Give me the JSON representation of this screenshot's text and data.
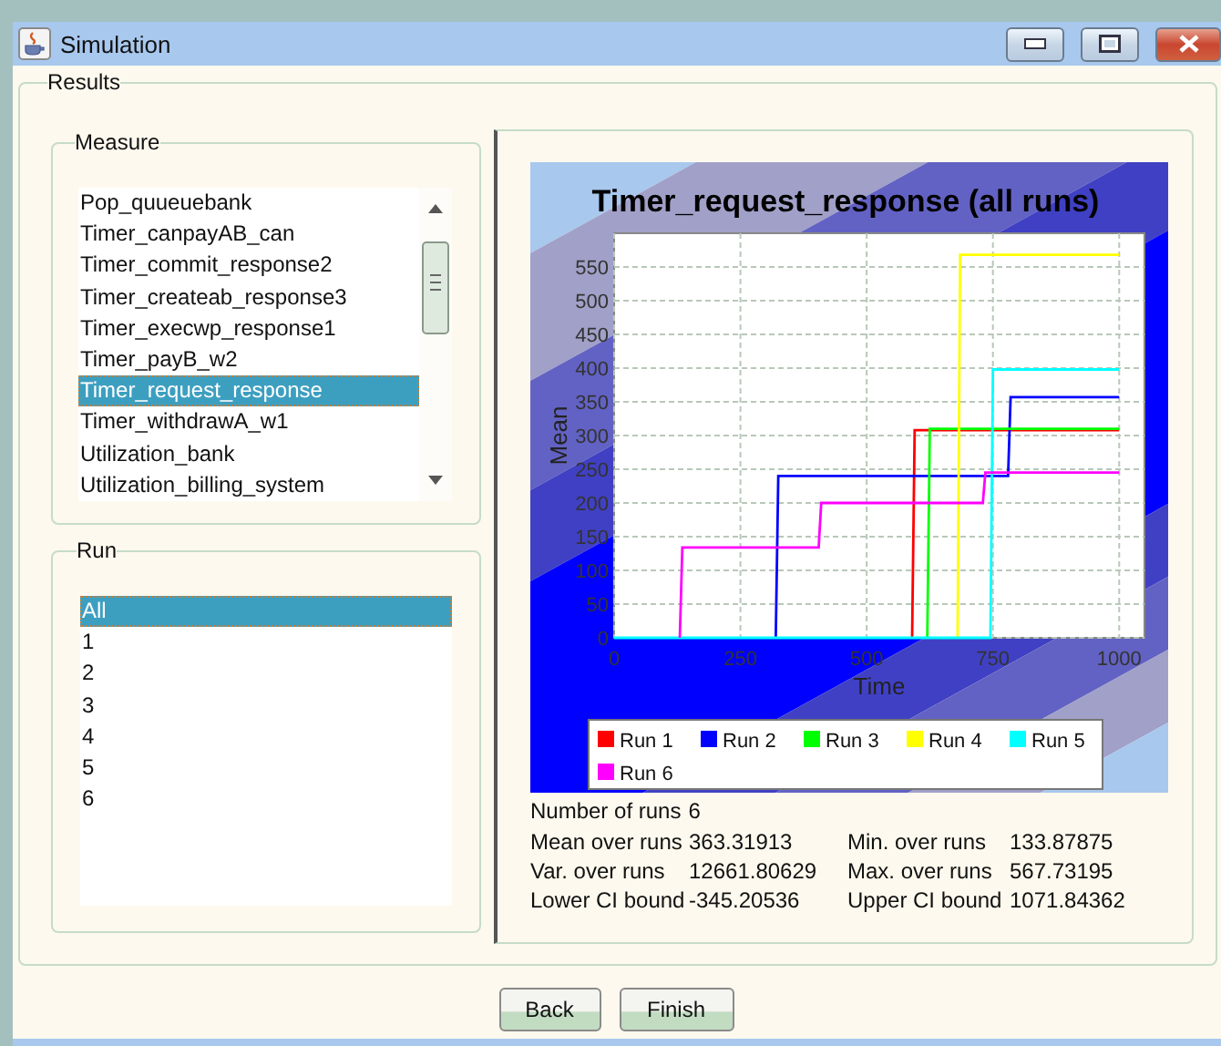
{
  "window": {
    "title": "Simulation"
  },
  "results": {
    "title": "Results"
  },
  "measure": {
    "title": "Measure",
    "items": [
      {
        "label": "Pop_quueuebank",
        "selected": false
      },
      {
        "label": "Timer_canpayAB_can",
        "selected": false
      },
      {
        "label": "Timer_commit_response2",
        "selected": false
      },
      {
        "label": "Timer_createab_response3",
        "selected": false
      },
      {
        "label": "Timer_execwp_response1",
        "selected": false
      },
      {
        "label": "Timer_payB_w2",
        "selected": false
      },
      {
        "label": "Timer_request_response",
        "selected": true
      },
      {
        "label": "Timer_withdrawA_w1",
        "selected": false
      },
      {
        "label": "Utilization_bank",
        "selected": false
      },
      {
        "label": "Utilization_billing_system",
        "selected": false
      }
    ]
  },
  "run": {
    "title": "Run",
    "items": [
      {
        "label": "All",
        "selected": true
      },
      {
        "label": "1",
        "selected": false
      },
      {
        "label": "2",
        "selected": false
      },
      {
        "label": "3",
        "selected": false
      },
      {
        "label": "4",
        "selected": false
      },
      {
        "label": "5",
        "selected": false
      },
      {
        "label": "6",
        "selected": false
      }
    ]
  },
  "chart": {
    "chart_data": {
      "type": "line",
      "title": "Timer_request_response (all runs)",
      "xlabel": "Time",
      "ylabel": "Mean",
      "x": [
        0,
        130,
        135,
        320,
        325,
        405,
        410,
        590,
        595,
        620,
        625,
        680,
        685,
        730,
        735,
        745,
        750,
        780,
        785,
        1000
      ],
      "series": [
        {
          "name": "Run 1",
          "color": "#ff0000",
          "values": [
            null,
            null,
            null,
            null,
            null,
            null,
            null,
            0,
            308,
            308,
            308,
            308,
            308,
            308,
            308,
            308,
            308,
            308,
            308,
            308
          ]
        },
        {
          "name": "Run 2",
          "color": "#0000ff",
          "values": [
            null,
            null,
            null,
            0,
            240,
            240,
            240,
            240,
            240,
            240,
            240,
            240,
            240,
            240,
            240,
            240,
            240,
            240,
            357,
            357
          ]
        },
        {
          "name": "Run 3",
          "color": "#00ff00",
          "values": [
            null,
            null,
            null,
            null,
            null,
            null,
            null,
            null,
            null,
            0,
            310,
            310,
            310,
            310,
            310,
            310,
            310,
            310,
            310,
            310
          ]
        },
        {
          "name": "Run 4",
          "color": "#ffff00",
          "values": [
            null,
            null,
            null,
            null,
            null,
            null,
            null,
            null,
            null,
            null,
            null,
            0,
            568,
            568,
            568,
            568,
            568,
            568,
            568,
            568
          ]
        },
        {
          "name": "Run 5",
          "color": "#00ffff",
          "values": [
            0,
            0,
            0,
            0,
            0,
            0,
            0,
            0,
            0,
            0,
            0,
            0,
            0,
            0,
            0,
            0,
            398,
            398,
            398,
            398
          ]
        },
        {
          "name": "Run 6",
          "color": "#ff00ff",
          "values": [
            null,
            0,
            134,
            134,
            134,
            134,
            200,
            200,
            200,
            200,
            200,
            200,
            200,
            200,
            245,
            245,
            245,
            245,
            245,
            245
          ]
        }
      ],
      "grid": true,
      "legend": true,
      "xlim": [
        0,
        1050
      ],
      "ylim": [
        0,
        600
      ],
      "xticks": [
        0,
        250,
        500,
        750,
        1000
      ],
      "yticks": [
        0,
        50,
        100,
        150,
        200,
        250,
        300,
        350,
        400,
        450,
        500,
        550
      ]
    }
  },
  "statistics": {
    "summary": {
      "label": "Number of runs",
      "value": "6"
    },
    "rows": [
      {
        "label": "Mean over runs",
        "value": "363.31913"
      },
      {
        "label": "Min. over runs",
        "value": "133.87875"
      },
      {
        "label": "Var. over runs",
        "value": "12661.80629"
      },
      {
        "label": "Max. over runs",
        "value": "567.73195"
      },
      {
        "label": "Lower CI bound",
        "value": "-345.20536"
      },
      {
        "label": "Upper CI bound",
        "value": "1071.84362"
      }
    ]
  },
  "buttons": [
    {
      "label": "Back"
    },
    {
      "label": "Finish"
    }
  ]
}
